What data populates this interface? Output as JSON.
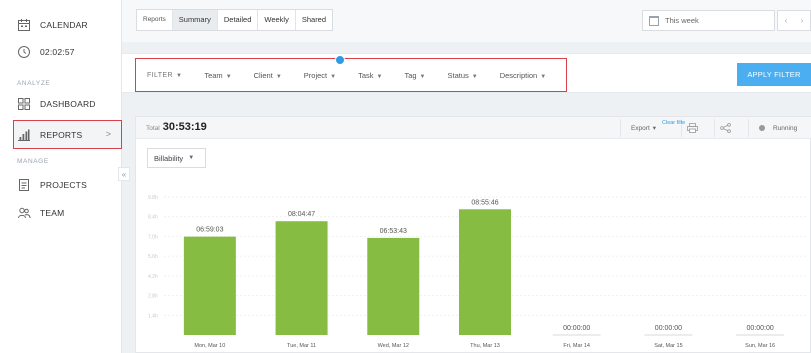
{
  "sidebar": {
    "calendar_label": "CALENDAR",
    "timer_label": "02:02:57",
    "analyze_heading": "ANALYZE",
    "dashboard_label": "DASHBOARD",
    "reports_label": "REPORTS",
    "manage_heading": "MANAGE",
    "projects_label": "PROJECTS",
    "team_label": "TEAM",
    "collapse_glyph": "«",
    "chevron_glyph": ">"
  },
  "tabs": [
    {
      "label": "Reports"
    },
    {
      "label": "Summary"
    },
    {
      "label": "Detailed"
    },
    {
      "label": "Weekly"
    },
    {
      "label": "Shared"
    }
  ],
  "date_range": {
    "label": "This week",
    "prev": "‹",
    "next": "›"
  },
  "filters": {
    "title": "FILTER",
    "items": [
      {
        "label": "Team"
      },
      {
        "label": "Client"
      },
      {
        "label": "Project"
      },
      {
        "label": "Task"
      },
      {
        "label": "Tag"
      },
      {
        "label": "Status"
      },
      {
        "label": "Description"
      }
    ],
    "apply_label": "APPLY FILTER",
    "clear_label": "Clear filte"
  },
  "report": {
    "total_label": "Total",
    "total_value": "30:53:19",
    "export_label": "Export",
    "running_label": "Running",
    "billability_label": "Billability"
  },
  "colors": {
    "bar": "#86bc42",
    "accent": "#4aaef0",
    "highlight": "#d8414c"
  },
  "chart_data": {
    "type": "bar",
    "categories": [
      "Mon, Mar 10",
      "Tue, Mar 11",
      "Wed, Mar 12",
      "Thu, Mar 13",
      "Fri, Mar 14",
      "Sat, Mar 15",
      "Sun, Mar 16"
    ],
    "values": [
      6.984,
      8.08,
      6.895,
      8.929,
      0,
      0,
      0
    ],
    "data_labels": [
      "06:59:03",
      "08:04:47",
      "06:53:43",
      "08:55:46",
      "00:00:00",
      "00:00:00",
      "00:00:00"
    ],
    "ylim": [
      0,
      9.8
    ],
    "yticks": [
      1.4,
      2.8,
      4.2,
      5.6,
      7.0,
      8.4,
      9.8
    ],
    "ytick_labels": [
      "1.4h",
      "2.8h",
      "4.2h",
      "5.6h",
      "7.0h",
      "8.4h",
      "9.8h"
    ],
    "grid": true
  }
}
